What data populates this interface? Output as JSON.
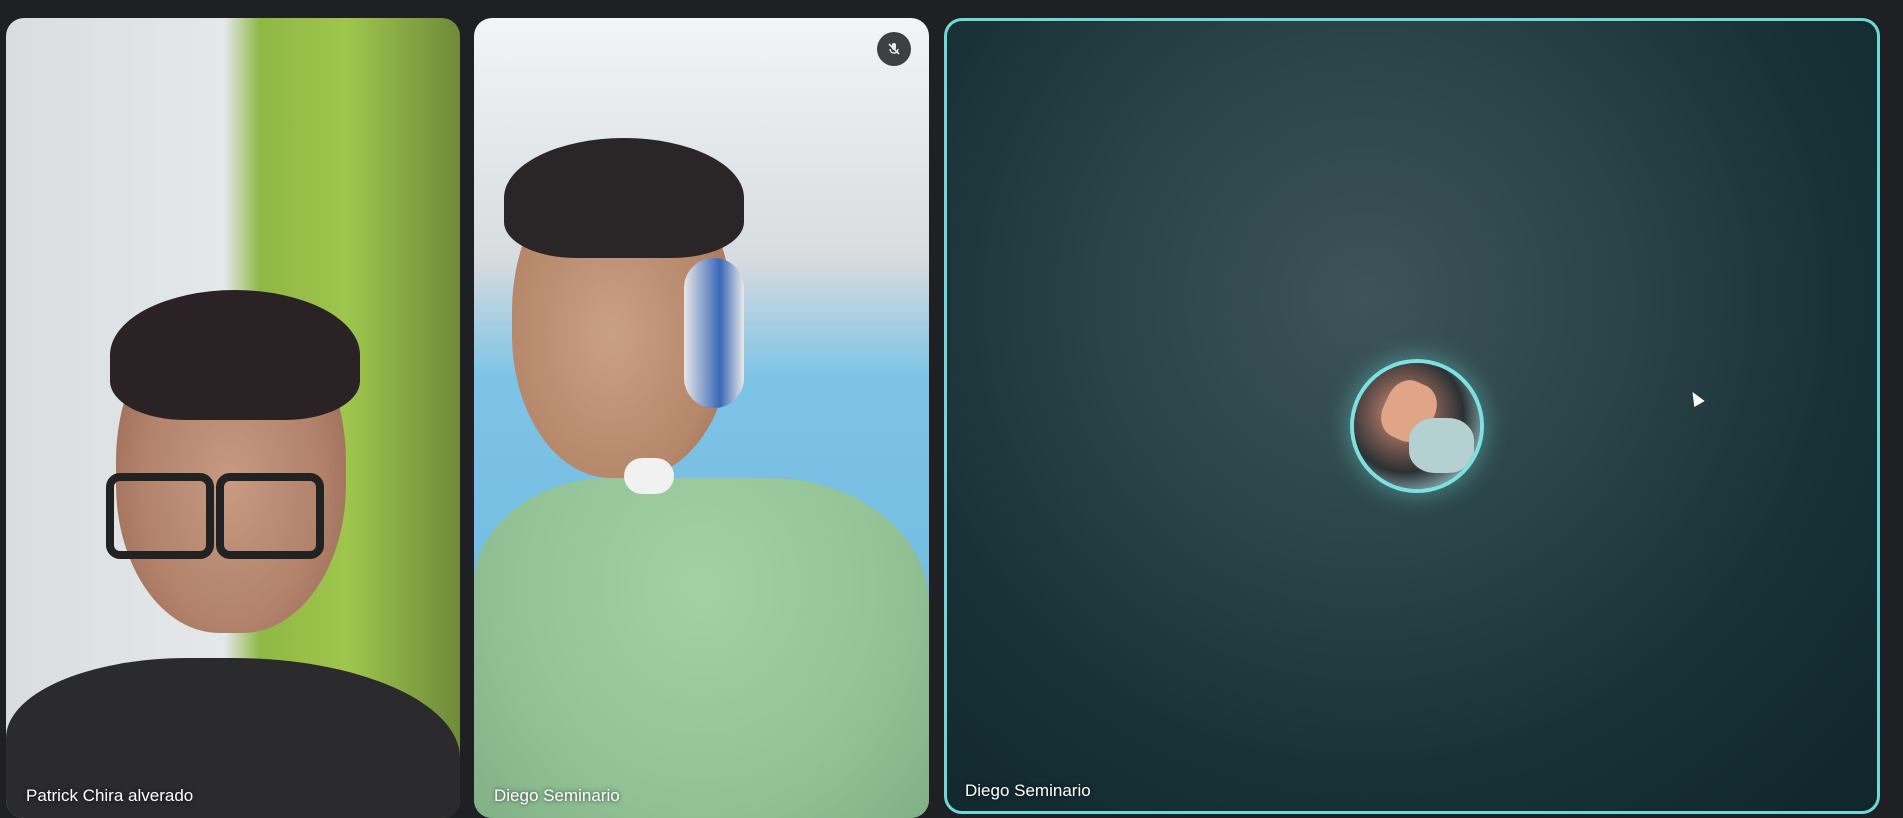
{
  "participants": [
    {
      "name": "Patrick Chira alverado"
    },
    {
      "name": "Diego Seminario"
    },
    {
      "name": "Diego Seminario"
    }
  ],
  "icons": {
    "muted": "mic-off-icon",
    "cursor": "pointer-cursor-icon"
  },
  "colors": {
    "background": "#1f2023",
    "active_speaker_border": "#6fd7d7"
  }
}
